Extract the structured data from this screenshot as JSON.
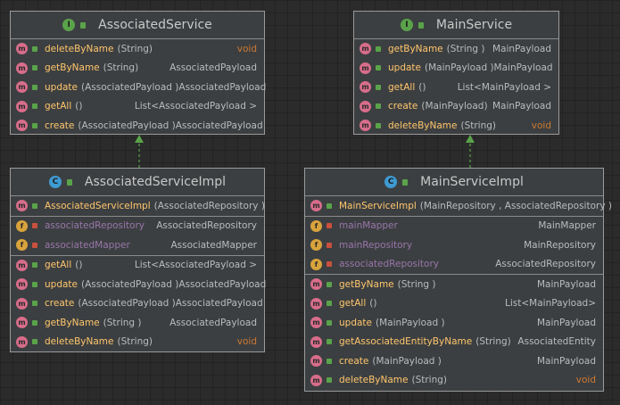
{
  "boxes": {
    "assoc_service": {
      "kind": "I",
      "title": "AssociatedService",
      "methods": [
        {
          "name": "deleteByName",
          "params": "(String)",
          "type": "void"
        },
        {
          "name": "getByName",
          "params": "(String)",
          "type": "AssociatedPayload"
        },
        {
          "name": "update",
          "params": "(AssociatedPayload )",
          "type": "AssociatedPayload"
        },
        {
          "name": "getAll",
          "params": "()",
          "type": "List<AssociatedPayload >"
        },
        {
          "name": "create",
          "params": "(AssociatedPayload )",
          "type": "AssociatedPayload"
        }
      ]
    },
    "main_service": {
      "kind": "I",
      "title": "MainService",
      "methods": [
        {
          "name": "getByName",
          "params": "(String )",
          "type": "MainPayload"
        },
        {
          "name": "update",
          "params": "(MainPayload )",
          "type": "MainPayload"
        },
        {
          "name": "getAll",
          "params": "()",
          "type": "List<MainPayload >"
        },
        {
          "name": "create",
          "params": "(MainPayload)",
          "type": "MainPayload"
        },
        {
          "name": "deleteByName",
          "params": "(String)",
          "type": "void"
        }
      ]
    },
    "assoc_impl": {
      "kind": "C",
      "title": "AssociatedServiceImpl",
      "constructor": {
        "name": "AssociatedServiceImpl",
        "params": "(AssociatedRepository )"
      },
      "fields": [
        {
          "name": "associatedRepository",
          "type": "AssociatedRepository"
        },
        {
          "name": "associatedMapper",
          "type": "AssociatedMapper"
        }
      ],
      "methods": [
        {
          "name": "getAll",
          "params": "()",
          "type": "List<AssociatedPayload >"
        },
        {
          "name": "update",
          "params": "(AssociatedPayload )",
          "type": "AssociatedPayload"
        },
        {
          "name": "create",
          "params": "(AssociatedPayload )",
          "type": "AssociatedPayload"
        },
        {
          "name": "getByName",
          "params": "(String )",
          "type": "AssociatedPayload"
        },
        {
          "name": "deleteByName",
          "params": "(String)",
          "type": "void"
        }
      ]
    },
    "main_impl": {
      "kind": "C",
      "title": "MainServiceImpl",
      "constructor": {
        "name": "MainServiceImpl",
        "params": "(MainRepository , AssociatedRepository )"
      },
      "fields": [
        {
          "name": "mainMapper",
          "type": "MainMapper"
        },
        {
          "name": "mainRepository",
          "type": "MainRepository"
        },
        {
          "name": "associatedRepository",
          "type": "AssociatedRepository"
        }
      ],
      "methods": [
        {
          "name": "getByName",
          "params": "(String )",
          "type": "MainPayload"
        },
        {
          "name": "getAll",
          "params": "()",
          "type": "List<MainPayload>"
        },
        {
          "name": "update",
          "params": "(MainPayload )",
          "type": "MainPayload"
        },
        {
          "name": "getAssociatedEntityByName",
          "params": "(String)",
          "type": "AssociatedEntity"
        },
        {
          "name": "create",
          "params": "(MainPayload )",
          "type": "MainPayload"
        },
        {
          "name": "deleteByName",
          "params": "(String)",
          "type": "void"
        }
      ]
    }
  },
  "colors": {
    "interface_badge": "#5aa34a",
    "class_badge": "#3e9ad1",
    "method_icon": "#d86d8b",
    "field_icon": "#d9a33c",
    "arrow": "#5aa34a"
  }
}
